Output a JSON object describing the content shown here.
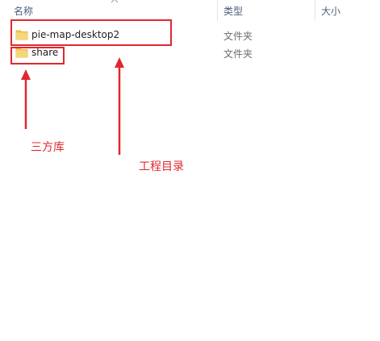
{
  "header": {
    "name_label": "名称",
    "type_label": "类型",
    "size_label": "大小"
  },
  "files": [
    {
      "name": "pie-map-desktop2",
      "type": "文件夹",
      "icon": "folder-icon"
    },
    {
      "name": "share",
      "type": "文件夹",
      "icon": "folder-icon"
    }
  ],
  "annotations": {
    "third_party_label": "三方库",
    "project_dir_label": "工程目录",
    "color": "#e0282f"
  },
  "colors": {
    "folder": "#f3c95a",
    "header_text": "#4c607a"
  }
}
